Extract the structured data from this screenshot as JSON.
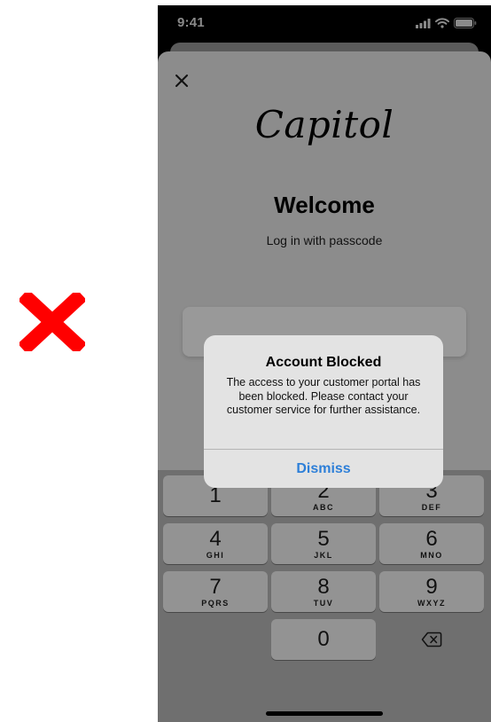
{
  "status_bar": {
    "time": "9:41"
  },
  "app": {
    "logo_text": "Capitol",
    "title": "Welcome",
    "subtitle": "Log in with passcode"
  },
  "alert": {
    "title": "Account Blocked",
    "message": "The access to your customer portal has been blocked. Please contact your customer service for further assistance.",
    "dismiss_label": "Dismiss"
  },
  "keypad": {
    "keys": [
      {
        "digit": "1",
        "letters": ""
      },
      {
        "digit": "2",
        "letters": "ABC"
      },
      {
        "digit": "3",
        "letters": "DEF"
      },
      {
        "digit": "4",
        "letters": "GHI"
      },
      {
        "digit": "5",
        "letters": "JKL"
      },
      {
        "digit": "6",
        "letters": "MNO"
      },
      {
        "digit": "7",
        "letters": "PQRS"
      },
      {
        "digit": "8",
        "letters": "TUV"
      },
      {
        "digit": "9",
        "letters": "WXYZ"
      },
      {
        "digit": "0",
        "letters": ""
      }
    ]
  },
  "colors": {
    "cross_mark": "#ff0000",
    "dismiss_accent": "#2d7fd8",
    "dimmed_background": "#8c8c8c",
    "alert_background": "#e3e3e3"
  },
  "icons": {
    "cross_mark": "red-x-icon",
    "close": "close-icon",
    "signal": "signal-icon",
    "wifi": "wifi-icon",
    "battery": "battery-icon",
    "backspace": "backspace-icon"
  }
}
